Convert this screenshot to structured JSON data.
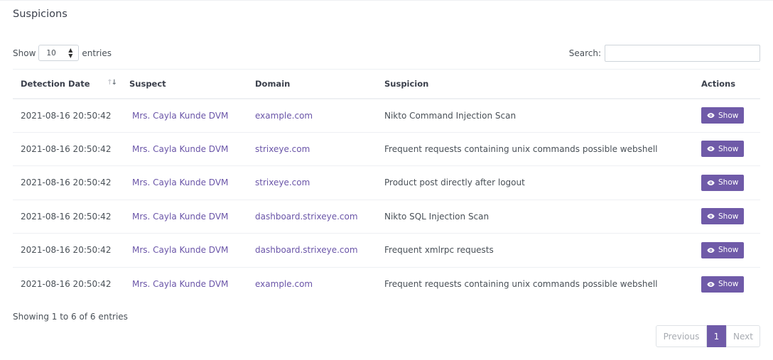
{
  "card": {
    "title": "Suspicions"
  },
  "length": {
    "show_label": "Show",
    "selected": "10",
    "entries_label": "entries"
  },
  "search": {
    "label": "Search:",
    "value": ""
  },
  "table": {
    "columns": [
      "Detection Date",
      "Suspect",
      "Domain",
      "Suspicion",
      "Actions"
    ],
    "rows": [
      {
        "date": "2021-08-16 20:50:42",
        "suspect": "Mrs. Cayla Kunde DVM",
        "domain": "example.com",
        "suspicion": "Nikto Command Injection Scan",
        "action": "Show"
      },
      {
        "date": "2021-08-16 20:50:42",
        "suspect": "Mrs. Cayla Kunde DVM",
        "domain": "strixeye.com",
        "suspicion": "Frequent requests containing unix commands possible webshell",
        "action": "Show"
      },
      {
        "date": "2021-08-16 20:50:42",
        "suspect": "Mrs. Cayla Kunde DVM",
        "domain": "strixeye.com",
        "suspicion": "Product post directly after logout",
        "action": "Show"
      },
      {
        "date": "2021-08-16 20:50:42",
        "suspect": "Mrs. Cayla Kunde DVM",
        "domain": "dashboard.strixeye.com",
        "suspicion": "Nikto SQL Injection Scan",
        "action": "Show"
      },
      {
        "date": "2021-08-16 20:50:42",
        "suspect": "Mrs. Cayla Kunde DVM",
        "domain": "dashboard.strixeye.com",
        "suspicion": "Frequent xmlrpc requests",
        "action": "Show"
      },
      {
        "date": "2021-08-16 20:50:42",
        "suspect": "Mrs. Cayla Kunde DVM",
        "domain": "example.com",
        "suspicion": "Frequent requests containing unix commands possible webshell",
        "action": "Show"
      }
    ]
  },
  "info": "Showing 1 to 6 of 6 entries",
  "pagination": {
    "previous": "Previous",
    "current": "1",
    "next": "Next"
  },
  "colors": {
    "accent": "#6f5aa8",
    "link": "#6a55a8"
  }
}
